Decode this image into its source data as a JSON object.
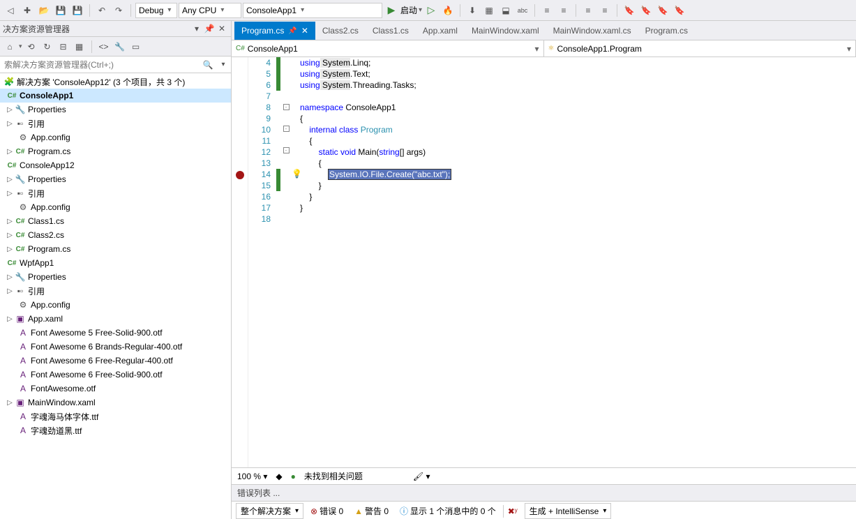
{
  "toolbar": {
    "config": "Debug",
    "platform": "Any CPU",
    "startup": "ConsoleApp1",
    "launch": "启动"
  },
  "solution": {
    "panelTitle": "决方案资源管理器",
    "searchPlaceholder": "索解决方案资源管理器(Ctrl+;)",
    "root": "解决方案 'ConsoleApp12' (3 个项目，共 3 个)",
    "p1": {
      "name": "ConsoleApp1",
      "properties": "Properties",
      "refs": "引用",
      "appconfig": "App.config",
      "program": "Program.cs"
    },
    "p2": {
      "name": "ConsoleApp12",
      "properties": "Properties",
      "refs": "引用",
      "appconfig": "App.config",
      "class1": "Class1.cs",
      "class2": "Class2.cs",
      "program": "Program.cs"
    },
    "p3": {
      "name": "WpfApp1",
      "properties": "Properties",
      "refs": "引用",
      "appconfig": "App.config",
      "appxaml": "App.xaml",
      "f1": "Font Awesome 5 Free-Solid-900.otf",
      "f2": "Font Awesome 6 Brands-Regular-400.otf",
      "f3": "Font Awesome 6 Free-Regular-400.otf",
      "f4": "Font Awesome 6 Free-Solid-900.otf",
      "f5": "FontAwesome.otf",
      "mainwin": "MainWindow.xaml",
      "f6": "字魂海马体字体.ttf",
      "f7": "字魂劲道黑.ttf"
    }
  },
  "tabs": {
    "t0": "Program.cs",
    "t1": "Class2.cs",
    "t2": "Class1.cs",
    "t3": "App.xaml",
    "t4": "MainWindow.xaml",
    "t5": "MainWindow.xaml.cs",
    "t6": "Program.cs"
  },
  "nav": {
    "left": "ConsoleApp1",
    "right": "ConsoleApp1.Program"
  },
  "code": {
    "lines": [
      "4",
      "5",
      "6",
      "7",
      "8",
      "9",
      "10",
      "11",
      "12",
      "13",
      "14",
      "15",
      "16",
      "17",
      "18"
    ],
    "l4a": "using",
    "l4b": " System",
    "l4c": ".Linq;",
    "l5a": "using",
    "l5b": " System",
    "l5c": ".Text;",
    "l6a": "using",
    "l6b": " System",
    "l6c": ".Threading.Tasks;",
    "l8a": "namespace",
    "l8b": " ConsoleApp1",
    "l9": "{",
    "l10a": "    internal",
    "l10b": " class",
    "l10c": " Program",
    "l11": "    {",
    "l12a": "        static",
    "l12b": " void",
    "l12c": " Main",
    "l12d": "(",
    "l12e": "string",
    "l12f": "[] args)",
    "l13": "        {",
    "l14": "System.IO.File.Create(\"abc.txt\");",
    "l15": "        }",
    "l16": "    }",
    "l17": "}"
  },
  "footer": {
    "zoom": "100 %",
    "noIssues": "未找到相关问题"
  },
  "errors": {
    "title": "错误列表 ...",
    "scope": "整个解决方案",
    "errBtn": "错误 0",
    "warnBtn": "警告 0",
    "msgBtn": "显示 1 个消息中的 0 个",
    "intelli": "生成 + IntelliSense"
  }
}
